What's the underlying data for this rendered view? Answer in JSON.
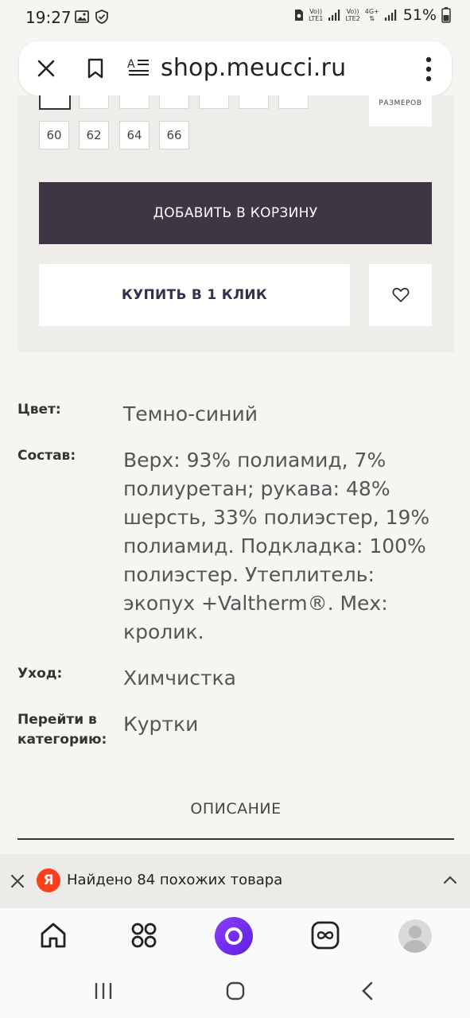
{
  "status_bar": {
    "time": "19:27",
    "sim1_top": "Vo))",
    "sim1_bottom": "LTE1",
    "sim2_top": "Vo))",
    "sim2_bottom": "LTE2",
    "net_type": "4G+",
    "battery": "51%",
    "icons": [
      "image-icon",
      "shield-check-icon",
      "signal-icon",
      "battery-icon"
    ]
  },
  "browser": {
    "url": "shop.meucci.ru",
    "icons": [
      "close-icon",
      "bookmark-icon",
      "reader-mode-icon",
      "more-vert-icon"
    ]
  },
  "product": {
    "sizes_row2": [
      "60",
      "62",
      "64",
      "66"
    ],
    "sizes_table_label": "РАЗМЕРОВ",
    "add_to_cart": "ДОБАВИТЬ В КОРЗИНУ",
    "buy_one_click": "КУПИТЬ В 1 КЛИК"
  },
  "properties": [
    {
      "label": "Цвет:",
      "value": "Темно-синий"
    },
    {
      "label": "Состав:",
      "value": "Верх: 93% полиамид, 7% полиуретан; рукава: 48% шерсть, 33% полиэстер, 19% полиамид. Подкладка: 100% полиэстер. Утеплитель: экопух +Valtherm®. Мех: кролик."
    },
    {
      "label": "Уход:",
      "value": "Химчистка"
    },
    {
      "label": "Перейти в категорию:",
      "value": "Куртки"
    }
  ],
  "description_tab": "ОПИСАНИЕ",
  "promo": {
    "logo_letter": "Я",
    "text": "Найдено 84 похожих товара"
  },
  "colors": {
    "primary_button": "#3d3645",
    "accent_alice": "#7b2ff7",
    "yandex_red": "#fc3f1d"
  }
}
